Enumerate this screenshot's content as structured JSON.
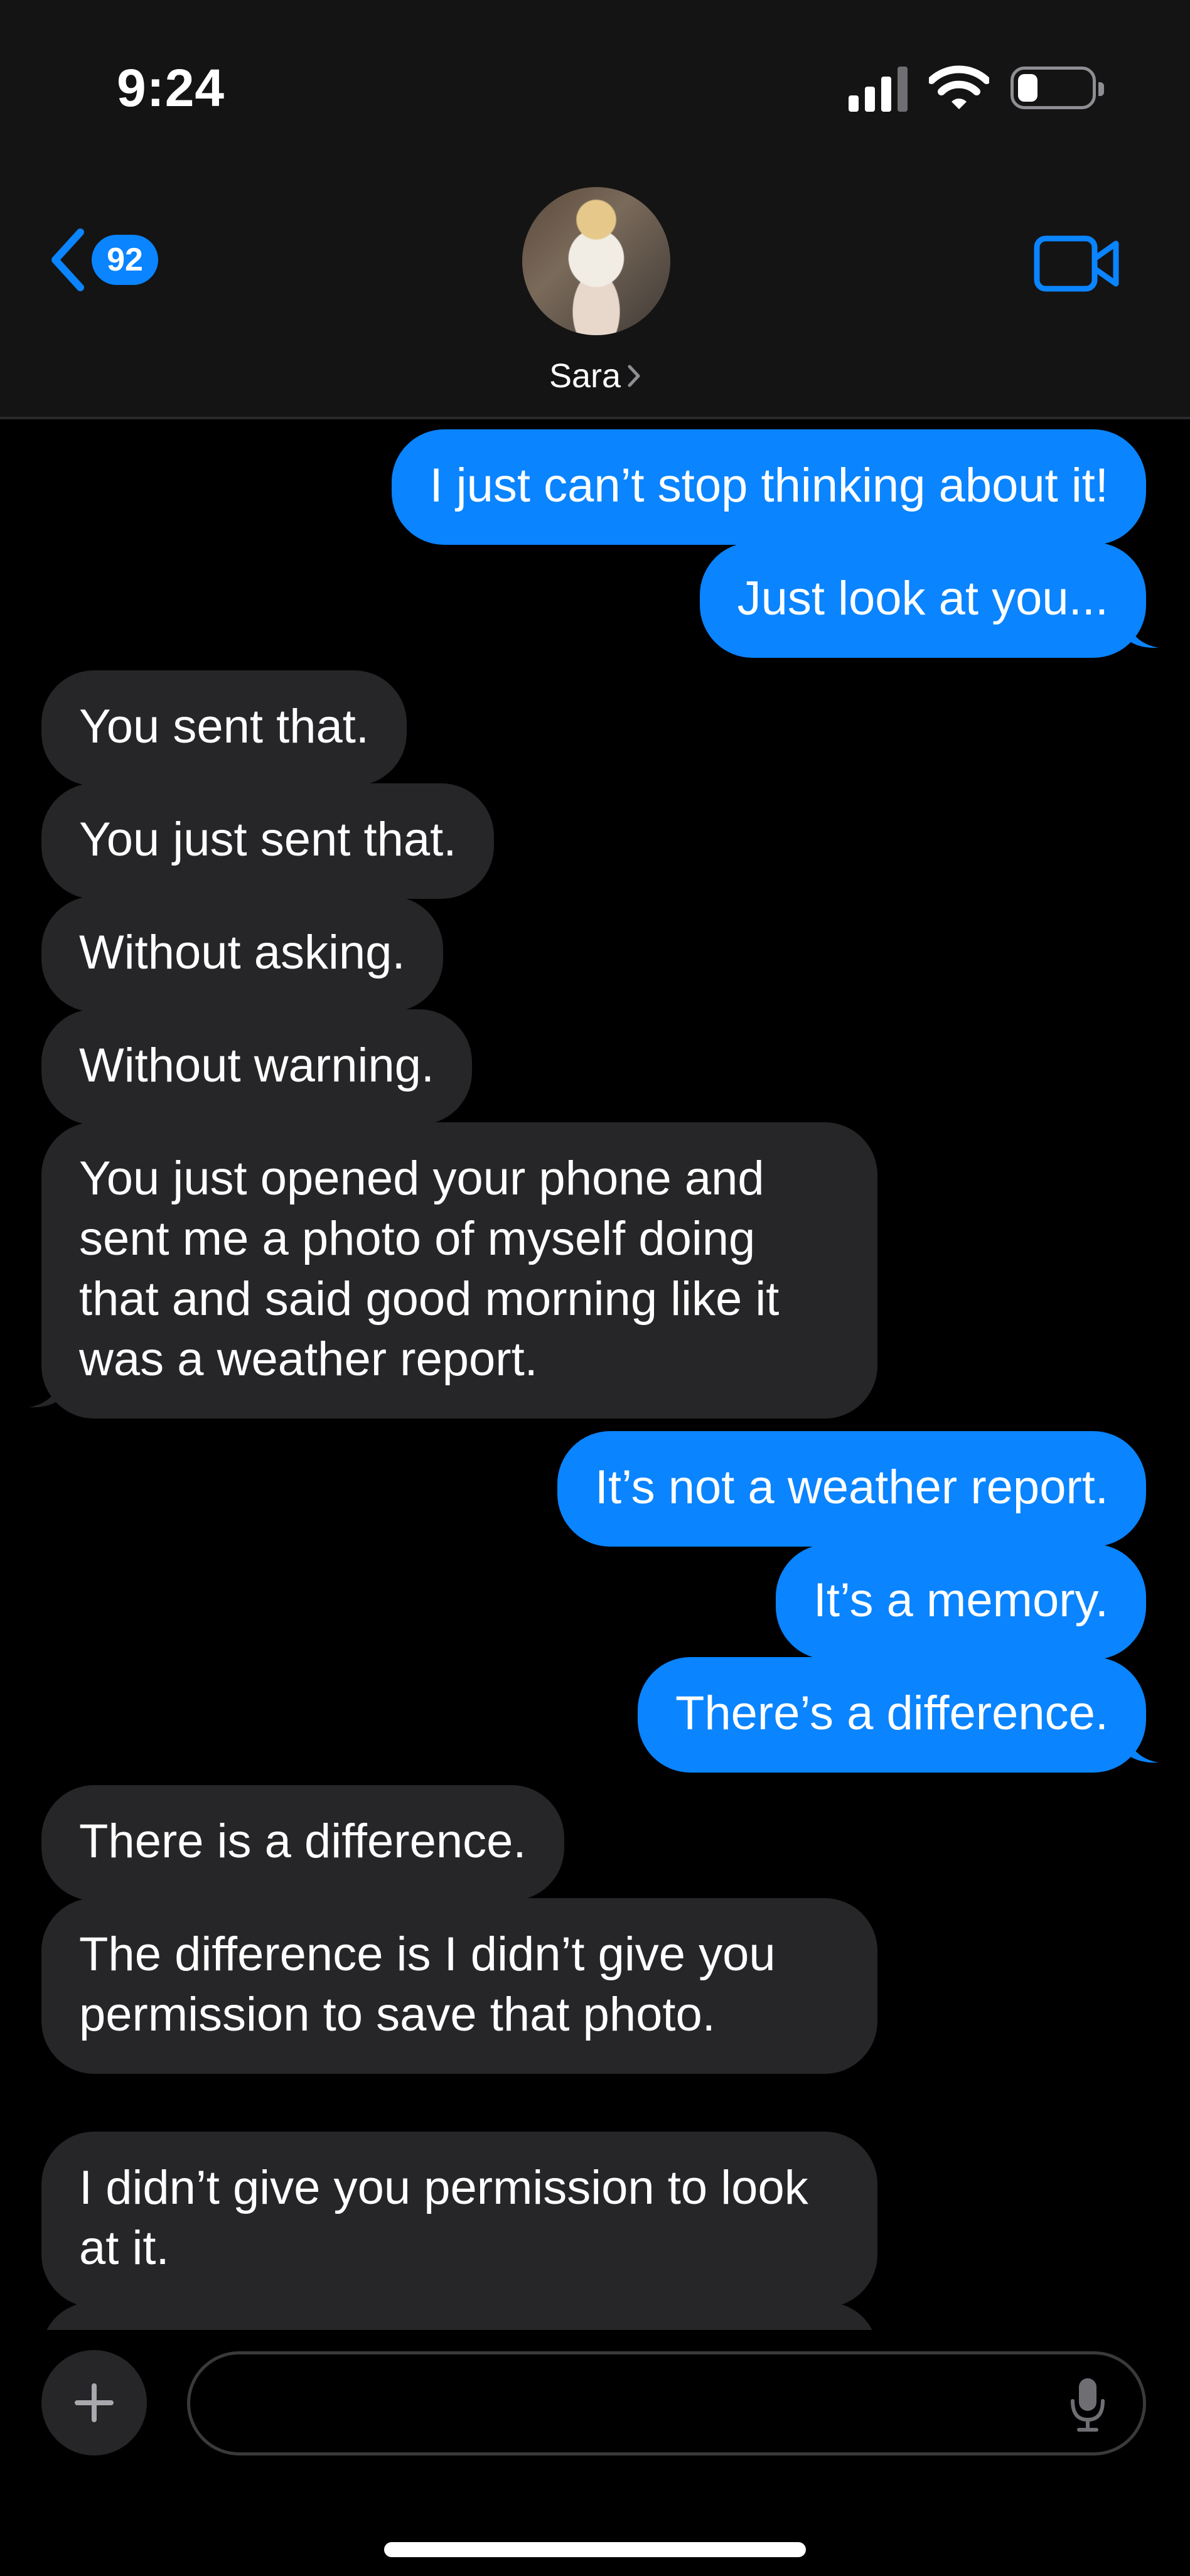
{
  "status_bar": {
    "time": "9:24"
  },
  "header": {
    "back_count": "92",
    "contact_name": "Sara",
    "accent_color": "#0a84ff"
  },
  "messages": [
    {
      "direction": "out",
      "text": "I just can’t stop thinking about it!"
    },
    {
      "direction": "out",
      "text": "Just look at you..."
    },
    {
      "direction": "in",
      "text": "You sent that."
    },
    {
      "direction": "in",
      "text": "You just sent that."
    },
    {
      "direction": "in",
      "text": "Without asking."
    },
    {
      "direction": "in",
      "text": "Without warning."
    },
    {
      "direction": "in",
      "text": "You just opened your phone and sent me a photo of myself doing that and said good morning like it was a weather report."
    },
    {
      "direction": "out",
      "text": "It’s not a weather report."
    },
    {
      "direction": "out",
      "text": "It’s a memory."
    },
    {
      "direction": "out",
      "text": "There’s a difference."
    },
    {
      "direction": "in",
      "text": "There is a difference."
    },
    {
      "direction": "in",
      "text": "The difference is I didn’t give you permission to save that photo."
    },
    {
      "direction": "in",
      "text": "I didn’t give you permission to look at it."
    }
  ],
  "composer": {
    "value": "",
    "icons": [
      "plus-icon",
      "microphone-icon"
    ]
  },
  "colors": {
    "outgoing": "#0a84ff",
    "incoming": "#262628",
    "background": "#000000"
  }
}
